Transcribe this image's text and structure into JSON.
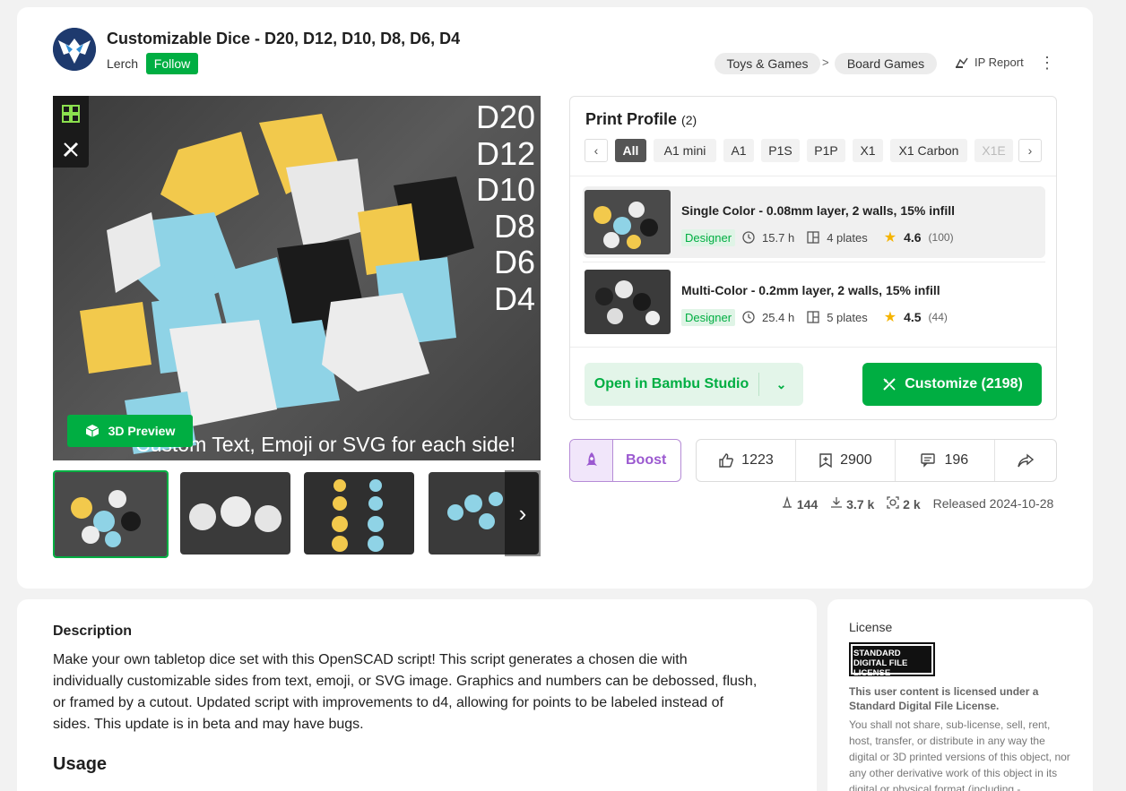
{
  "model": {
    "title": "Customizable Dice - D20, D12, D10, D8, D6, D4",
    "author": "Lerch",
    "follow_label": "Follow"
  },
  "breadcrumbs": [
    "Toys & Games",
    "Board Games"
  ],
  "breadcrumb_separator": ">",
  "ip_report_label": "IP Report",
  "gallery": {
    "overlay_labels": [
      "D20",
      "D12",
      "D10",
      "D8",
      "D6",
      "D4"
    ],
    "caption": "Custom Text, Emoji or SVG for each side!",
    "preview_button": "3D Preview"
  },
  "print_profile": {
    "title": "Print Profile",
    "count": "(2)",
    "filters": [
      "All",
      "A1 mini",
      "A1",
      "P1S",
      "P1P",
      "X1",
      "X1 Carbon",
      "X1E"
    ],
    "active_filter": "All",
    "profiles": [
      {
        "name": "Single Color - 0.08mm layer, 2 walls, 15% infill",
        "tag": "Designer",
        "time": "15.7 h",
        "plates": "4 plates",
        "rating": "4.6",
        "rating_count": "(100)"
      },
      {
        "name": "Multi-Color - 0.2mm layer, 2 walls, 15% infill",
        "tag": "Designer",
        "time": "25.4 h",
        "plates": "5 plates",
        "rating": "4.5",
        "rating_count": "(44)"
      }
    ],
    "open_button": "Open in Bambu Studio",
    "customize_button": "Customize  (2198)"
  },
  "engagement": {
    "boost_label": "Boost",
    "likes": "1223",
    "collects": "2900",
    "comments": "196"
  },
  "meta": {
    "prints": "144",
    "downloads": "3.7 k",
    "views": "2 k",
    "released": "Released 2024-10-28"
  },
  "description": {
    "heading": "Description",
    "text": "Make your own tabletop dice set with this OpenSCAD script! This script generates a chosen die with individually customizable sides from text, emoji, or SVG image. Graphics and numbers can be debossed, flush, or framed by a cutout. Updated script with improvements to d4, allowing for points to be labeled instead of sides. This update is in beta and may have bugs.",
    "usage_heading": "Usage"
  },
  "license": {
    "heading": "License",
    "badge": "STANDARD DIGITAL FILE LICENSE",
    "summary": "This user content is licensed under a Standard Digital File License.",
    "text": "You shall not share, sub-license, sell, rent, host, transfer, or distribute in any way the digital or 3D printed versions of this object, nor any other derivative work of this object in its digital or physical format (including -"
  },
  "colors": {
    "brand_green": "#00ae42",
    "boost_purple": "#9b59d0",
    "star": "#f5b400"
  },
  "icons": [
    "avatar-logo",
    "makerworld-icon",
    "ruler-icon",
    "cube-icon",
    "chevron-left-icon",
    "chevron-right-icon",
    "clock-icon",
    "plates-icon",
    "star-icon",
    "chevron-down-icon",
    "customize-icon",
    "rocket-icon",
    "thumbs-up-icon",
    "bookmark-icon",
    "comment-icon",
    "share-icon",
    "print-icon",
    "download-icon",
    "view-icon",
    "ip-report-icon",
    "more-icon"
  ]
}
